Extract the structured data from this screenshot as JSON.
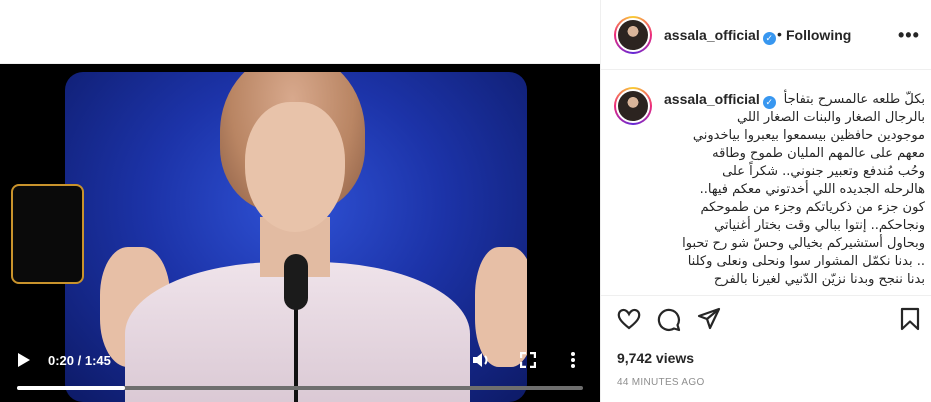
{
  "video": {
    "current_time": "0:20",
    "duration": "1:45",
    "time_separator": " / ",
    "progress": 0.19
  },
  "header": {
    "username": "assala_official",
    "separator": "•",
    "follow_label": "Following",
    "more_label": "•••"
  },
  "caption": {
    "username": "assala_official",
    "lines": [
      "بكلّ طلعه عالمسرح بتفاجأ",
      "بالرجال الصغار والبنات الصغار اللي",
      "موجودين حافظين بيسمعوا بيعبروا بياخدوني",
      "معهم على عالمهم المليان طموح وطاقه",
      "وحُب مُندفع وتعبير جنوني.. شكراً على",
      "هالرحله الجديده اللي أخدتوني معكم فيها..",
      "كون جزء من ذكرياتكم وجزء من طموحكم",
      "ونجاحكم.. إنتوا ببالي وقت بختار أغنياتي",
      "وبحاول أستشيركم بخيالي وحسّ شو رح تحبوا",
      ".. بدنا نكمّل المشوار سوا ونحلى ونعلى وكلنا",
      "بدنا ننجح وبدنا نزيّن الدّنيي لغيرنا بالفرح"
    ]
  },
  "stats": {
    "views": "9,742 views",
    "time_ago": "44 MINUTES AGO"
  },
  "icons": {
    "like": "heart-icon",
    "comment": "comment-icon",
    "share": "share-icon",
    "save": "bookmark-icon",
    "verified": "verified-badge-icon"
  },
  "colors": {
    "verified": "#3897f0",
    "text": "#262626",
    "muted": "#8e8e8e"
  }
}
